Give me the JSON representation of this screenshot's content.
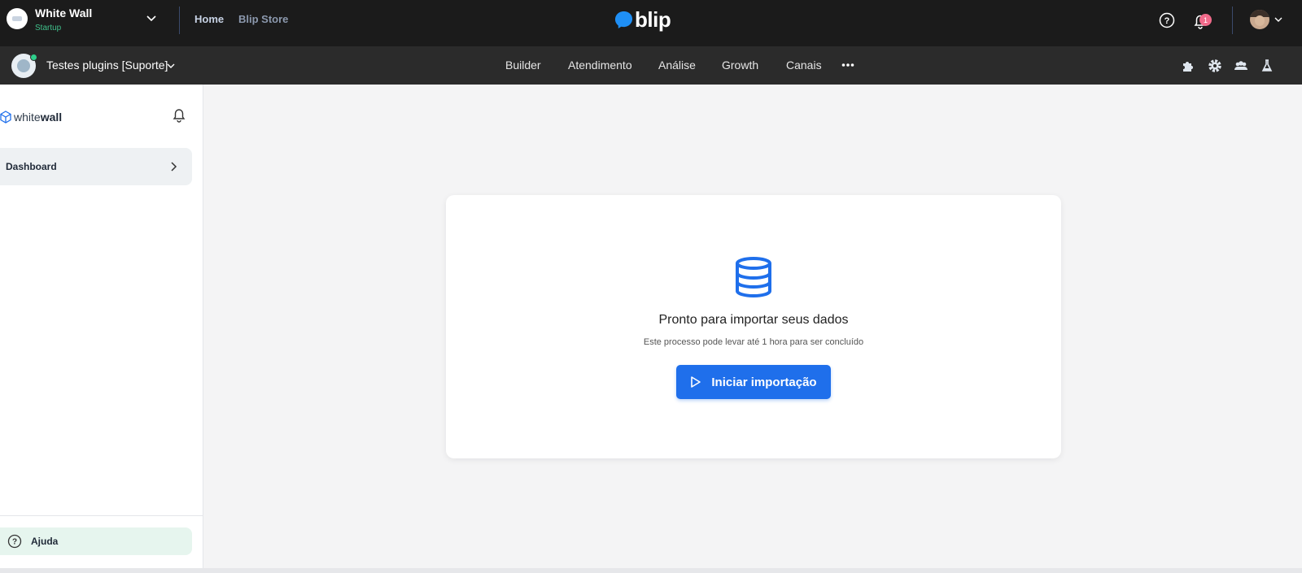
{
  "org": {
    "name": "White Wall",
    "plan": "Startup"
  },
  "topnav": {
    "home": "Home",
    "store": "Blip Store"
  },
  "brand": {
    "name": "blip",
    "color": "#1f8ff5"
  },
  "notifications": {
    "count": "1"
  },
  "bot": {
    "name": "Testes plugins [Suporte]"
  },
  "subnav": [
    "Builder",
    "Atendimento",
    "Análise",
    "Growth",
    "Canais"
  ],
  "sidebar": {
    "logo_thin": "white",
    "logo_bold": "wall",
    "dashboard": "Dashboard",
    "help": "Ajuda"
  },
  "main": {
    "title": "Pronto para importar seus dados",
    "subtitle": "Este processo pode levar até 1 hora para ser concluído",
    "button": "Iniciar importação",
    "accent": "#1f6feb"
  },
  "icons": {
    "tools": [
      "puzzle-icon",
      "gear-icon",
      "users-icon",
      "flask-icon"
    ]
  }
}
